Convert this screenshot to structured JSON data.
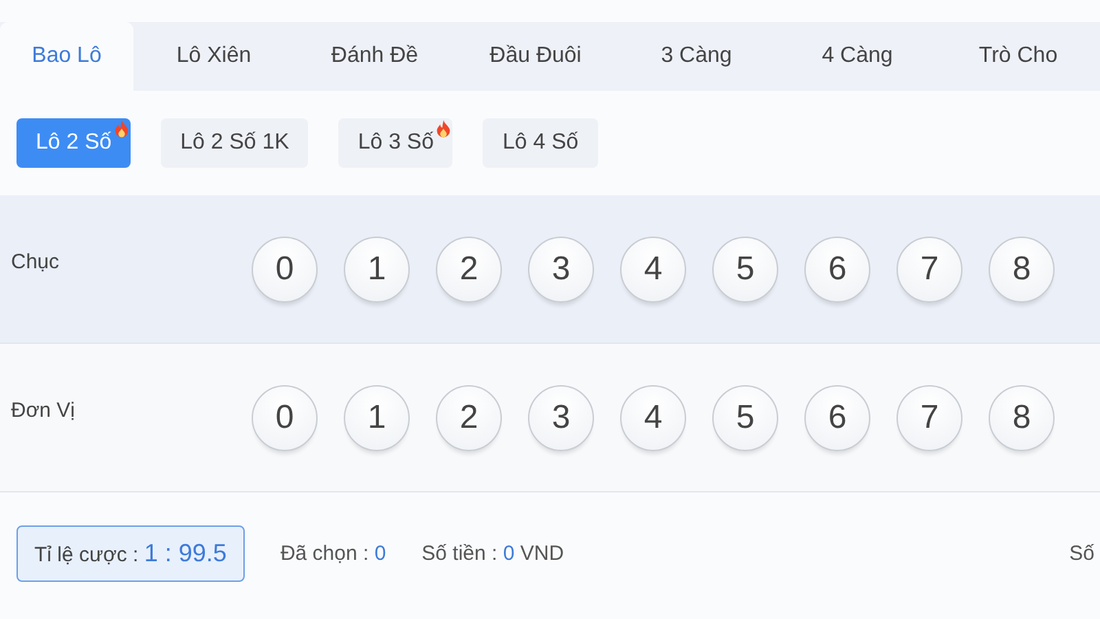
{
  "tabs": [
    {
      "label": "Bao Lô",
      "selected": true
    },
    {
      "label": "Lô Xiên",
      "selected": false
    },
    {
      "label": "Đánh Đề",
      "selected": false
    },
    {
      "label": "Đầu Đuôi",
      "selected": false
    },
    {
      "label": "3 Càng",
      "selected": false
    },
    {
      "label": "4 Càng",
      "selected": false
    },
    {
      "label": "Trò Cho",
      "selected": false
    }
  ],
  "subtabs": [
    {
      "label": "Lô 2 Số",
      "selected": true,
      "hot": true
    },
    {
      "label": "Lô 2 Số 1K",
      "selected": false,
      "hot": false
    },
    {
      "label": "Lô 3 Số",
      "selected": false,
      "hot": true
    },
    {
      "label": "Lô 4 Số",
      "selected": false,
      "hot": false
    }
  ],
  "rows": [
    {
      "label": "Chục",
      "balls": [
        "0",
        "1",
        "2",
        "3",
        "4",
        "5",
        "6",
        "7",
        "8"
      ]
    },
    {
      "label": "Đơn Vị",
      "balls": [
        "0",
        "1",
        "2",
        "3",
        "4",
        "5",
        "6",
        "7",
        "8"
      ]
    }
  ],
  "footer": {
    "odds_label": "Tỉ lệ cược :",
    "odds_value": "1 : 99.5",
    "chosen_label": "Đã chọn :",
    "chosen_value": "0",
    "amount_label": "Số tiền :",
    "amount_value": "0",
    "currency": "VND",
    "right_text": "Số"
  }
}
